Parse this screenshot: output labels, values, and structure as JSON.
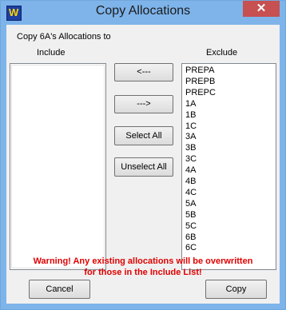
{
  "window": {
    "title": "Copy Allocations",
    "close_glyph": "✕",
    "app_icon_glyph": "W"
  },
  "labels": {
    "copy_to": "Copy 6A's Allocations to",
    "include": "Include",
    "exclude": "Exclude"
  },
  "buttons": {
    "move_left": "<---",
    "move_right": "--->",
    "select_all": "Select All",
    "unselect_all": "Unselect All",
    "cancel": "Cancel",
    "copy": "Copy"
  },
  "include_list": [],
  "exclude_list": [
    "PREPA",
    "PREPB",
    "PREPC",
    "1A",
    "1B",
    "1C",
    "3A",
    "3B",
    "3C",
    "4A",
    "4B",
    "4C",
    "5A",
    "5B",
    "5C",
    "6B",
    "6C"
  ],
  "warning": {
    "line1": "Warning! Any existing allocations will be overwritten",
    "line2": "for those in the Include List!"
  },
  "colors": {
    "warning": "#e00000",
    "titlebar": "#7eb4ea",
    "close_button": "#c75050"
  }
}
